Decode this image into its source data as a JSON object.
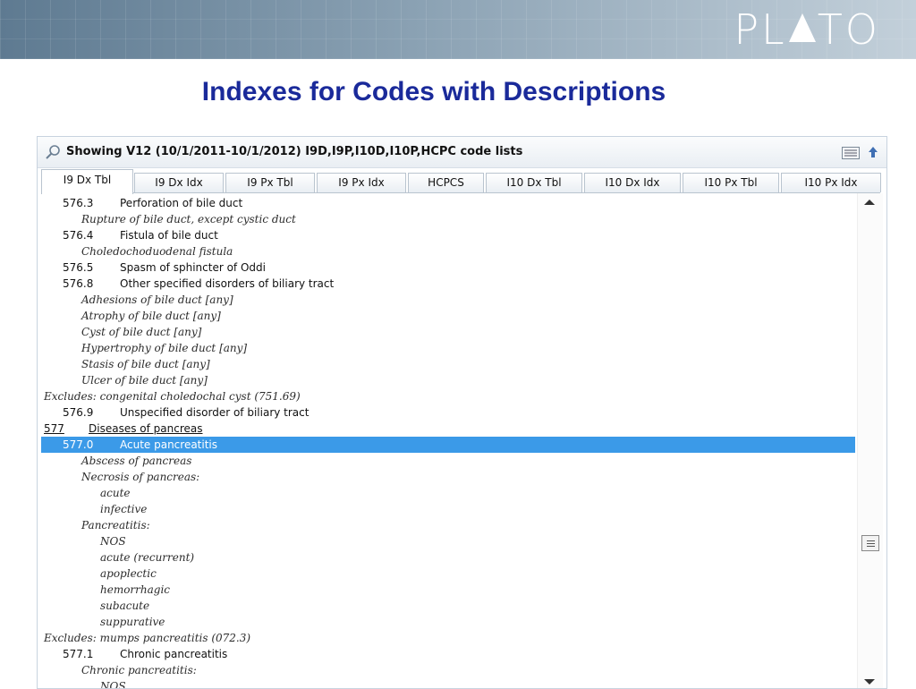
{
  "slide": {
    "logo": {
      "left": "PL",
      "right": "TO"
    },
    "title": "Indexes for Codes with Descriptions"
  },
  "window": {
    "header_title": "Showing V12 (10/1/2011-10/1/2012) I9D,I9P,I10D,I10P,HCPC code lists",
    "icons": [
      "search-icon",
      "list-menu-icon",
      "arrow-up-icon"
    ]
  },
  "tabs": [
    {
      "label": "I9 Dx Tbl",
      "active": true
    },
    {
      "label": "I9 Dx Idx"
    },
    {
      "label": "I9 Px Tbl"
    },
    {
      "label": "I9 Px Idx"
    },
    {
      "label": "HCPCS"
    },
    {
      "label": "I10 Dx Tbl"
    },
    {
      "label": "I10 Dx Idx"
    },
    {
      "label": "I10 Px Tbl"
    },
    {
      "label": "I10 Px Idx"
    }
  ],
  "rows": [
    {
      "type": "code",
      "code": "576.3",
      "desc": "Perforation of bile duct"
    },
    {
      "type": "note",
      "indent": 1,
      "text": "Rupture of bile duct, except cystic duct"
    },
    {
      "type": "code",
      "code": "576.4",
      "desc": "Fistula of bile duct"
    },
    {
      "type": "note",
      "indent": 1,
      "text": "Choledochoduodenal fistula"
    },
    {
      "type": "code",
      "code": "576.5",
      "desc": "Spasm of sphincter of Oddi"
    },
    {
      "type": "code",
      "code": "576.8",
      "desc": "Other specified disorders of biliary tract"
    },
    {
      "type": "note",
      "indent": 1,
      "text": "Adhesions of bile duct [any]"
    },
    {
      "type": "note",
      "indent": 1,
      "text": "Atrophy of bile duct [any]"
    },
    {
      "type": "note",
      "indent": 1,
      "text": "Cyst of bile duct [any]"
    },
    {
      "type": "note",
      "indent": 1,
      "text": "Hypertrophy of bile duct [any]"
    },
    {
      "type": "note",
      "indent": 1,
      "text": "Stasis of bile duct [any]"
    },
    {
      "type": "note",
      "indent": 1,
      "text": "Ulcer of bile duct [any]"
    },
    {
      "type": "note",
      "indent": 0,
      "text": "Excludes: congenital choledochal cyst (751.69)"
    },
    {
      "type": "code",
      "code": "576.9",
      "desc": "Unspecified disorder of biliary tract"
    },
    {
      "type": "cat",
      "code": "577",
      "desc": "Diseases of pancreas"
    },
    {
      "type": "code",
      "code": "577.0",
      "desc": "Acute pancreatitis",
      "selected": true
    },
    {
      "type": "note",
      "indent": 1,
      "text": "Abscess of pancreas"
    },
    {
      "type": "note",
      "indent": 1,
      "text": "Necrosis of pancreas:"
    },
    {
      "type": "note",
      "indent": 2,
      "text": "acute"
    },
    {
      "type": "note",
      "indent": 2,
      "text": "infective"
    },
    {
      "type": "note",
      "indent": 1,
      "text": "Pancreatitis:"
    },
    {
      "type": "note",
      "indent": 2,
      "text": "NOS"
    },
    {
      "type": "note",
      "indent": 2,
      "text": "acute (recurrent)"
    },
    {
      "type": "note",
      "indent": 2,
      "text": "apoplectic"
    },
    {
      "type": "note",
      "indent": 2,
      "text": "hemorrhagic"
    },
    {
      "type": "note",
      "indent": 2,
      "text": "subacute"
    },
    {
      "type": "note",
      "indent": 2,
      "text": "suppurative"
    },
    {
      "type": "note",
      "indent": 0,
      "text": "Excludes: mumps pancreatitis (072.3)"
    },
    {
      "type": "code",
      "code": "577.1",
      "desc": "Chronic pancreatitis"
    },
    {
      "type": "note",
      "indent": 1,
      "text": "Chronic pancreatitis:"
    },
    {
      "type": "note",
      "indent": 2,
      "text": "NOS"
    }
  ],
  "colors": {
    "title": "#1a2a9a",
    "selection": "#3b9ae8"
  }
}
